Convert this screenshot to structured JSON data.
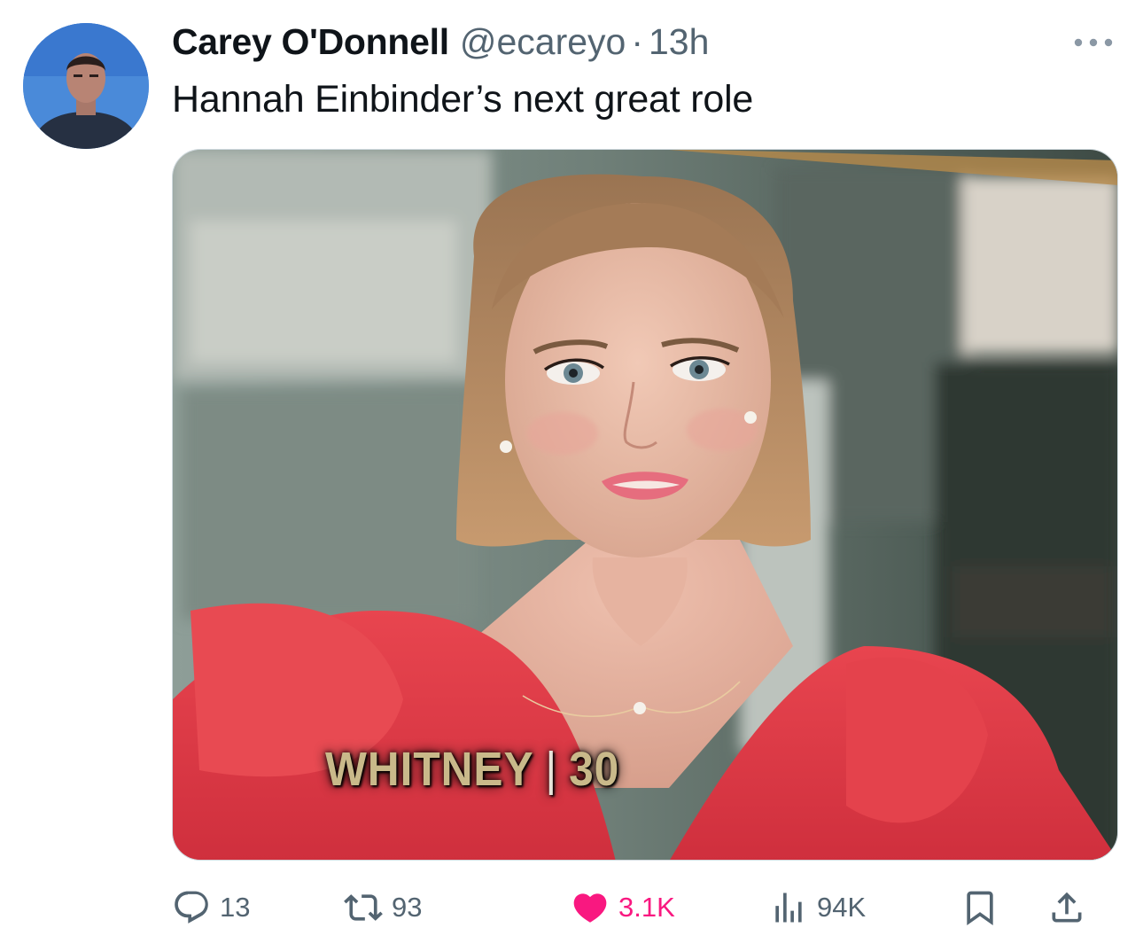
{
  "tweet": {
    "author_name": "Carey O'Donnell",
    "handle": "@ecareyo",
    "separator": "·",
    "time": "13h",
    "text": "Hannah Einbinder’s next great role",
    "more_icon": "more-horizontal-icon"
  },
  "media": {
    "overlay_caption_name": "WHITNEY",
    "overlay_caption_separator": "|",
    "overlay_caption_age": "30"
  },
  "actions": {
    "reply_count": "13",
    "retweet_count": "93",
    "like_count": "3.1K",
    "views_count": "94K",
    "reply_icon": "reply-icon",
    "retweet_icon": "retweet-icon",
    "like_icon": "heart-icon",
    "views_icon": "views-icon",
    "bookmark_icon": "bookmark-icon",
    "share_icon": "share-icon"
  },
  "colors": {
    "text": "#0f1419",
    "secondary": "#536471",
    "like_active": "#f91880",
    "caption_gold": "#c9b98a"
  }
}
